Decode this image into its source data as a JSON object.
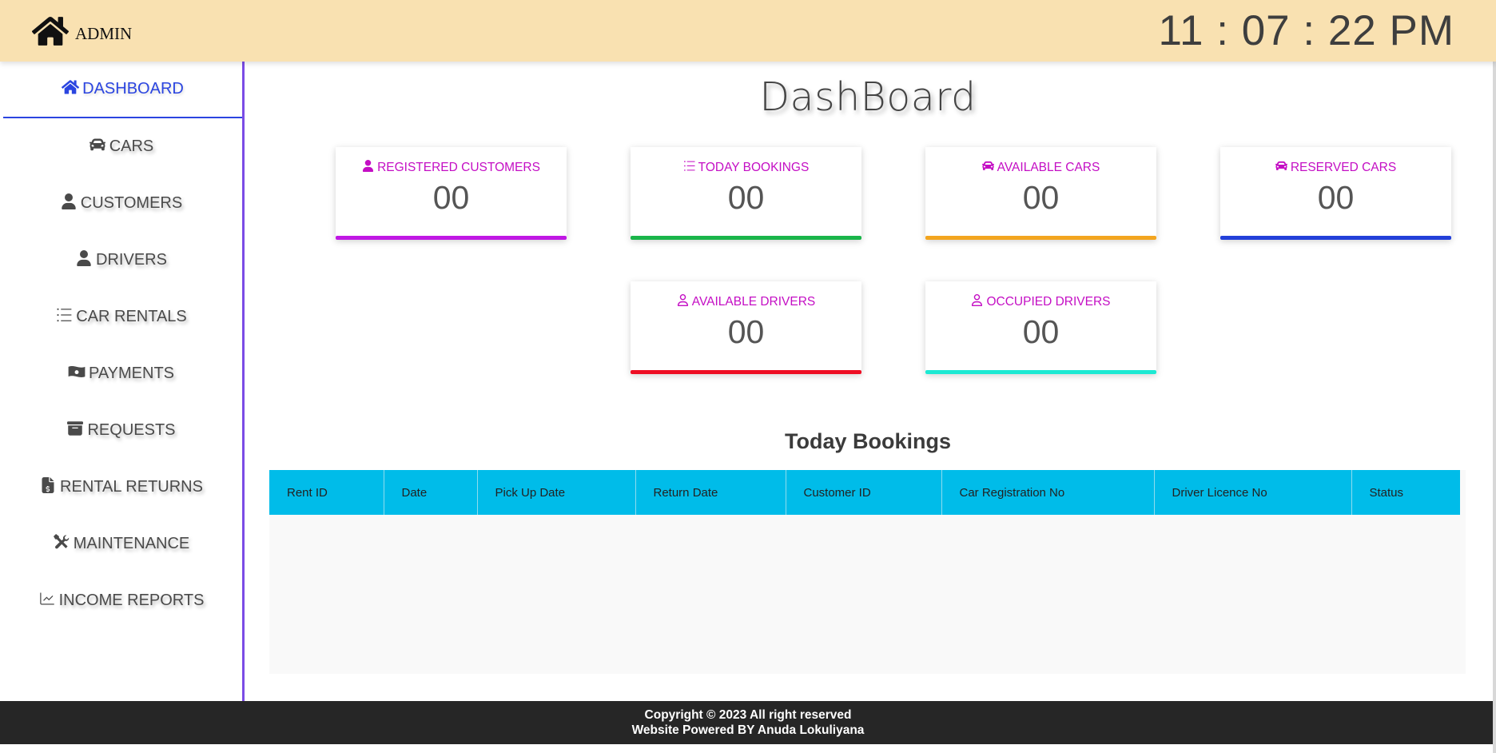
{
  "header": {
    "brand_label": "ADMIN",
    "clock": "11 : 07 : 22 PM",
    "background": "#f9e1b1"
  },
  "sidebar": {
    "accent": "#7b4ce6",
    "items": [
      {
        "label": "DASHBOARD",
        "icon": "home-icon",
        "active": true
      },
      {
        "label": "CARS",
        "icon": "car-icon"
      },
      {
        "label": "CUSTOMERS",
        "icon": "user-icon"
      },
      {
        "label": "DRIVERS",
        "icon": "user-icon"
      },
      {
        "label": "CAR RENTALS",
        "icon": "list-icon"
      },
      {
        "label": "PAYMENTS",
        "icon": "money-icon"
      },
      {
        "label": "REQUESTS",
        "icon": "archive-icon"
      },
      {
        "label": "RENTAL RETURNS",
        "icon": "invoice-icon"
      },
      {
        "label": "MAINTENANCE",
        "icon": "tools-icon"
      },
      {
        "label": "INCOME REPORTS",
        "icon": "chart-line-icon"
      }
    ]
  },
  "main": {
    "title": "DashBoard",
    "cards": [
      {
        "label": "REGISTERED CUSTOMERS",
        "value": "00",
        "icon": "user-icon",
        "color": "#c018e4"
      },
      {
        "label": "TODAY BOOKINGS",
        "value": "00",
        "icon": "list-icon",
        "color": "#1ab54a"
      },
      {
        "label": "AVAILABLE CARS",
        "value": "00",
        "icon": "car-icon",
        "color": "#f3a51f"
      },
      {
        "label": "RESERVED CARS",
        "value": "00",
        "icon": "car-icon",
        "color": "#2340d9"
      },
      {
        "label": "AVAILABLE DRIVERS",
        "value": "00",
        "icon": "user-outline-icon",
        "color": "#ee0e24"
      },
      {
        "label": "OCCUPIED DRIVERS",
        "value": "00",
        "icon": "user-outline-icon",
        "color": "#1de9d3"
      }
    ],
    "bookings": {
      "title": "Today Bookings",
      "columns": [
        "Rent ID",
        "Date",
        "Pick Up Date",
        "Return Date",
        "Customer ID",
        "Car Registration No",
        "Driver Licence No",
        "Status"
      ],
      "rows": []
    }
  },
  "footer": {
    "line1": "Copyright © 2023 All right reserved",
    "line2": "Website Powered BY Anuda Lokuliyana"
  }
}
